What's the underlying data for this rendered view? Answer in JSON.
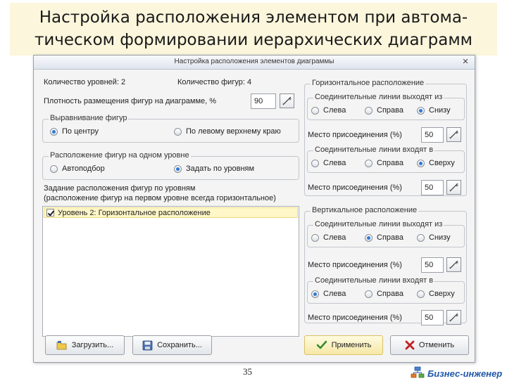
{
  "slide": {
    "title_line1": "Настройка расположения элементом при автома-",
    "title_line2": "тическом формировании иерархических диаграмм",
    "page_number": "35",
    "brand": "Бизнес-инженер"
  },
  "dialog": {
    "title": "Настройка расположения элементов диаграммы",
    "close": "✕",
    "levels_count": "Количество уровней: 2",
    "shapes_count": "Количество фигур: 4",
    "density_label": "Плотность размещения фигур на диаграмме, %",
    "density_value": "90",
    "align_group": {
      "title": "Выравнивание фигур",
      "options": [
        "По центру",
        "По левому верхнему краю"
      ],
      "selected": "По центру"
    },
    "level_layout_group": {
      "title": "Расположение фигур на одном уровне",
      "options": [
        "Автоподбор",
        "Задать по уровням"
      ],
      "selected": "Задать по уровням"
    },
    "levels_caption_line1": "Задание расположения фигур по уровням",
    "levels_caption_line2": "(расположение фигур на первом уровне всегда горизонтальное)",
    "levels_list": [
      {
        "label": "Уровень 2: Горизонтальное расположение",
        "checked": true
      }
    ],
    "horizontal": {
      "title": "Горизонтальное расположение",
      "exit_group": {
        "title": "Соединительные линии выходят из",
        "options": [
          "Слева",
          "Справа",
          "Снизу"
        ],
        "selected": "Снизу"
      },
      "exit_point_label": "Место присоединения (%)",
      "exit_point_value": "50",
      "enter_group": {
        "title": "Соединительные линии входят в",
        "options": [
          "Слева",
          "Справа",
          "Сверху"
        ],
        "selected": "Сверху"
      },
      "enter_point_label": "Место присоединения (%)",
      "enter_point_value": "50"
    },
    "vertical": {
      "title": "Вертикальное расположение",
      "exit_group": {
        "title": "Соединительные линии выходят из",
        "options": [
          "Слева",
          "Справа",
          "Снизу"
        ],
        "selected": "Справа"
      },
      "exit_point_label": "Место присоединения (%)",
      "exit_point_value": "50",
      "enter_group": {
        "title": "Соединительные линии входят в",
        "options": [
          "Слева",
          "Справа",
          "Сверху"
        ],
        "selected": "Слева"
      },
      "enter_point_label": "Место присоединения (%)",
      "enter_point_value": "50"
    },
    "buttons": {
      "load": "Загрузить...",
      "save": "Сохранить...",
      "apply": "Применить",
      "cancel": "Отменить"
    },
    "colors": {
      "accent": "#2f78d6",
      "primary_button": "#f6e8a6",
      "brand": "#1f57a8"
    }
  }
}
